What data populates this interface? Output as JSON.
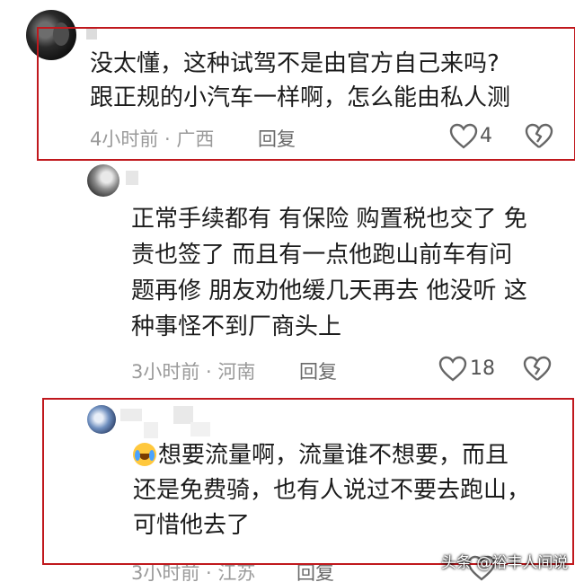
{
  "comments": [
    {
      "text_lines": [
        "没太懂，这种试驾不是由官方自己来吗?",
        "跟正规的小汽车一样啊，怎么能由私人测"
      ],
      "time": "4小时前",
      "location": "广西",
      "reply_label": "回复",
      "like_count": "4"
    },
    {
      "text_lines": [
        "正常手续都有 有保险 购置税也交了 免",
        "责也签了 而且有一点他跑山前车有问",
        "题再修 朋友劝他缓几天再去 他没听 这",
        "种事怪不到厂商头上"
      ],
      "time": "3小时前",
      "location": "河南",
      "reply_label": "回复",
      "like_count": "18"
    },
    {
      "text_lines": [
        "想要流量啊，流量谁不想要，而且",
        "还是免费骑，也有人说过不要去跑山，",
        "可惜他去了"
      ],
      "time": "3小时前",
      "location": "江苏",
      "reply_label": "回复"
    }
  ],
  "meta_separator": " · ",
  "watermark": "头条 @裕丰人间说",
  "colors": {
    "highlight": "#c0181d",
    "meta": "#9a9a9a",
    "text": "#1c1c1c"
  },
  "icons": [
    "like-heart-icon",
    "dislike-broken-heart-icon",
    "crying-laughing-emoji-icon"
  ]
}
